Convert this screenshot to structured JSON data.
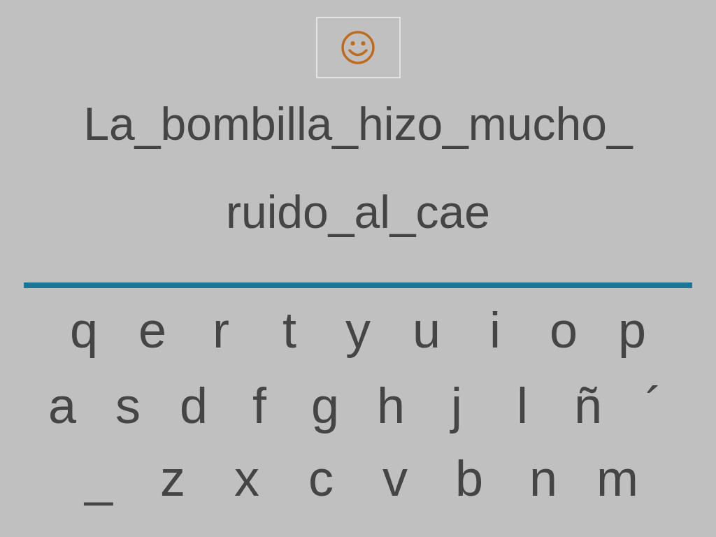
{
  "phrase_lines": [
    "La_bombilla_hizo_mucho_",
    "ruido_al_cae"
  ],
  "keyboard_rows": [
    [
      "q",
      "e",
      "r",
      "t",
      "y",
      "u",
      "i",
      "o",
      "p"
    ],
    [
      "a",
      "s",
      "d",
      "f",
      "g",
      "h",
      "j",
      "l",
      "ñ",
      "´"
    ],
    [
      "_",
      "z",
      "x",
      "c",
      "v",
      "b",
      "n",
      "m"
    ]
  ]
}
